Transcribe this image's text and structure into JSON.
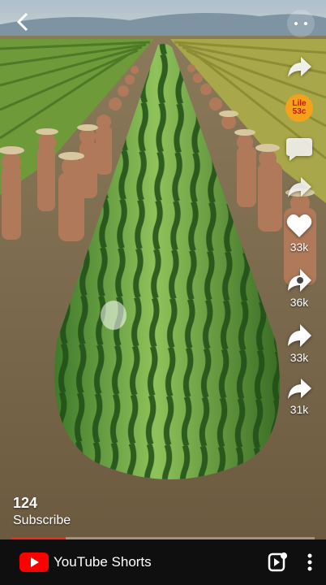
{
  "video": {
    "like_count": "33k",
    "comment_count": "36k",
    "remix_count": "33k",
    "share_count": "31k",
    "progress": 0.18
  },
  "caption": {
    "number": "124",
    "subscribe_label": "Subscribe"
  },
  "rail": {
    "badge_text": "Lile 53c"
  },
  "footer": {
    "brand": "YouTube Shorts"
  },
  "colors": {
    "brand_red": "#ff0000",
    "progress_red": "#e52d27",
    "badge_orange": "#f4a21c"
  },
  "icons": [
    "back-arrow-icon",
    "more-dots-icon",
    "share-arrow-icon",
    "comment-icon",
    "like-heart-icon",
    "remix-icon",
    "dislike-icon",
    "shorts-icon",
    "vertical-dots-icon",
    "youtube-play-icon"
  ]
}
